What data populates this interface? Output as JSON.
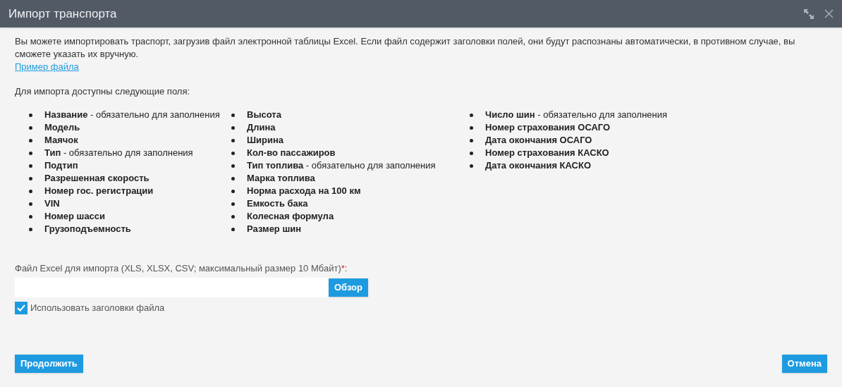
{
  "window": {
    "title": "Импорт транспорта"
  },
  "intro": "Вы можете импортировать траспорт, загрузив файл электронной таблицы Excel. Если файл содержит заголовки полей, они будут распознаны автоматически, в противном случае, вы сможете указать их вручную.",
  "example_link": "Пример файла",
  "fields_heading": "Для импорта доступны следующие поля:",
  "field_columns": [
    [
      {
        "name": "Название",
        "note": "- обязательно для заполнения"
      },
      {
        "name": "Модель"
      },
      {
        "name": "Маячок"
      },
      {
        "name": "Тип",
        "note": "- обязательно для заполнения"
      },
      {
        "name": "Подтип"
      },
      {
        "name": "Разрешенная скорость"
      },
      {
        "name": "Номер гос. регистрации"
      },
      {
        "name": "VIN"
      },
      {
        "name": "Номер шасси"
      },
      {
        "name": "Грузоподъемность"
      }
    ],
    [
      {
        "name": "Высота"
      },
      {
        "name": "Длина"
      },
      {
        "name": "Ширина"
      },
      {
        "name": "Кол-во пассажиров"
      },
      {
        "name": "Тип топлива",
        "note": "- обязательно для заполнения"
      },
      {
        "name": "Марка топлива"
      },
      {
        "name": "Норма расхода на 100 км"
      },
      {
        "name": "Емкость бака"
      },
      {
        "name": "Колесная формула"
      },
      {
        "name": "Размер шин"
      }
    ],
    [
      {
        "name": "Число шин",
        "note": "- обязательно для заполнения"
      },
      {
        "name": "Номер страхования ОСАГО"
      },
      {
        "name": "Дата окончания ОСАГО"
      },
      {
        "name": "Номер страхования КАСКО"
      },
      {
        "name": "Дата окончания КАСКО"
      }
    ]
  ],
  "file_field": {
    "label": "Файл Excel для импорта (XLS, XLSX, CSV; максимальный размер 10 Мбайт)",
    "required_mark": "*",
    "label_suffix": ":",
    "browse_button": "Обзор"
  },
  "use_headers": {
    "label": "Использовать заголовки файла",
    "checked": true
  },
  "buttons": {
    "continue": "Продолжить",
    "cancel": "Отмена"
  }
}
